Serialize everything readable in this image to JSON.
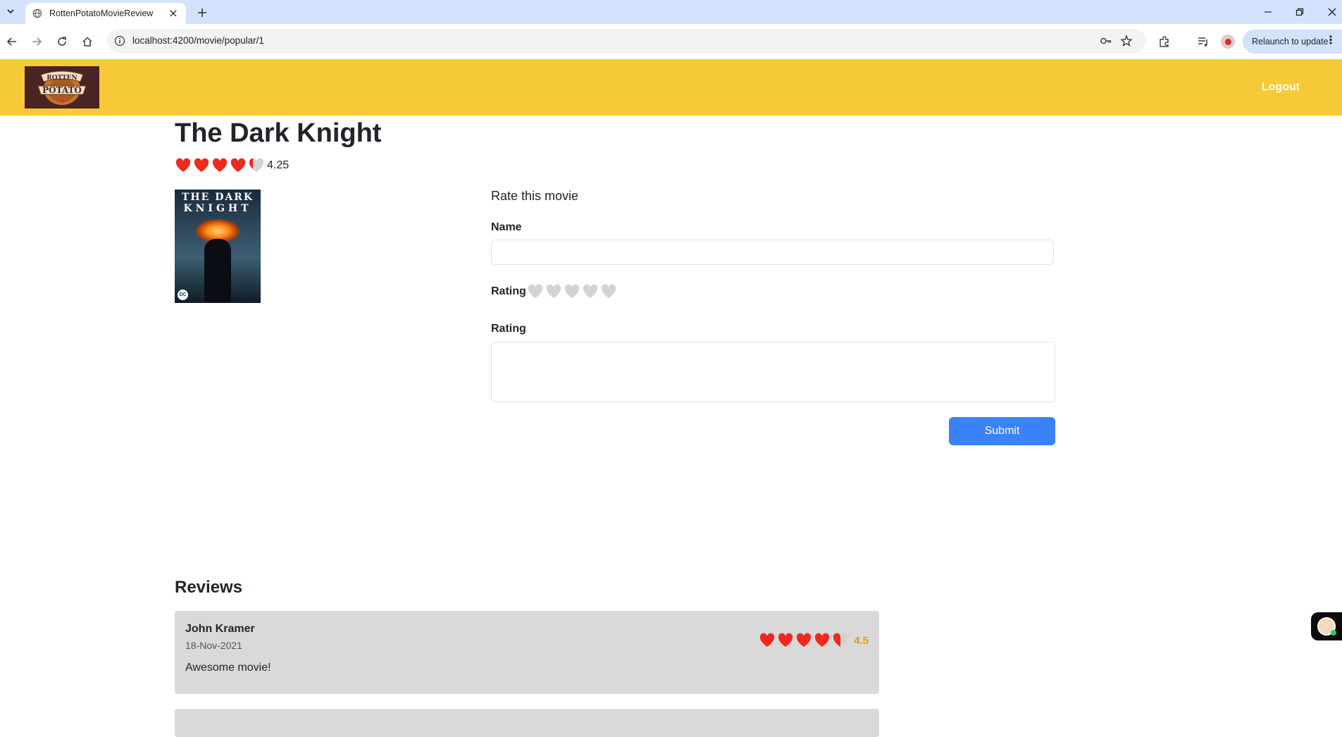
{
  "browser": {
    "tab_title": "RottenPotatoMovieReview",
    "url": "localhost:4200/movie/popular/1",
    "relaunch_label": "Relaunch to update"
  },
  "app": {
    "logo_line1": "ROTTEN",
    "logo_line2": "POTATO",
    "logout_label": "Logout",
    "colors": {
      "navbar": "#f6c938",
      "heart_filled": "#ee2a1e",
      "heart_empty": "#d3d3d3",
      "submit": "#3b82f6",
      "review_card": "#d9d9d9",
      "review_score": "#e89a1c"
    }
  },
  "movie": {
    "title": "The Dark Knight",
    "average_rating": "4.25",
    "poster_line1": "THE DARK",
    "poster_line2": "KNIGHT",
    "poster_badge": "DC"
  },
  "form": {
    "heading": "Rate this movie",
    "name_label": "Name",
    "name_value": "",
    "rating_label": "Rating",
    "review_label": "Rating",
    "review_value": "",
    "submit_label": "Submit",
    "selected_rating": 0
  },
  "reviews": {
    "heading": "Reviews",
    "items": [
      {
        "name": "John Kramer",
        "date": "18-Nov-2021",
        "text": "Awesome movie!",
        "score": "4.5"
      },
      {
        "name": "",
        "date": "",
        "text": "",
        "score": ""
      }
    ]
  }
}
